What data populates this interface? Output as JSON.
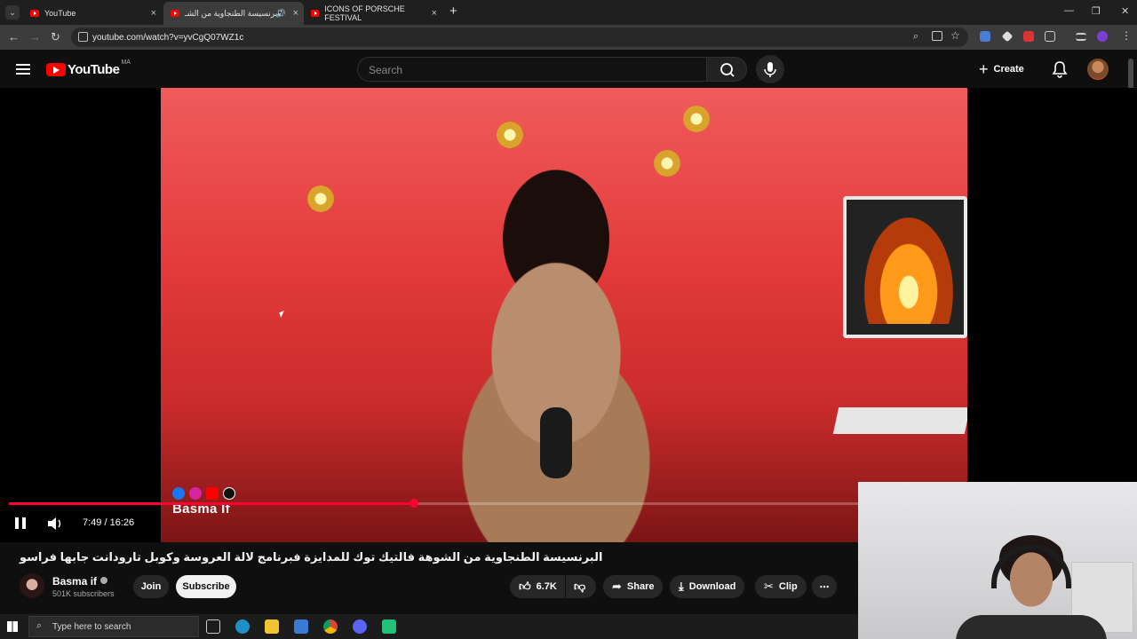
{
  "browser": {
    "tabs": [
      {
        "label": "YouTube"
      },
      {
        "label": "البرنسيسة الطنجاوية من الشـ"
      },
      {
        "label": "ICONS OF PORSCHE FESTIVAL"
      }
    ],
    "new_tab": "+",
    "close_glyph": "×",
    "url": "youtube.com/watch?v=yvCgQ07WZ1c"
  },
  "youtube": {
    "logo_text": "YouTube",
    "country_code": "MA",
    "search_placeholder": "Search",
    "create_label": "Create"
  },
  "video": {
    "social_handle": "Basma If",
    "time_display": "7:49 / 16:26",
    "progress": 0.475
  },
  "details": {
    "title": "البرنسيسة الطنجاوية من الشوهة فالتيك توك للمدايزة فبرنامج لالة العروسة وكوبل تارودانت جابها فراسو",
    "channel_name": "Basma if",
    "subscribers": "501K subscribers",
    "join_label": "Join",
    "subscribe_label": "Subscribe",
    "likes": "6.7K",
    "share_label": "Share",
    "download_label": "Download",
    "clip_label": "Clip"
  },
  "taskbar": {
    "search_placeholder": "Type here to search"
  },
  "colors": {
    "accent": "#ff0033",
    "yt_red": "#ff0000",
    "background": "#0f0f0f"
  }
}
